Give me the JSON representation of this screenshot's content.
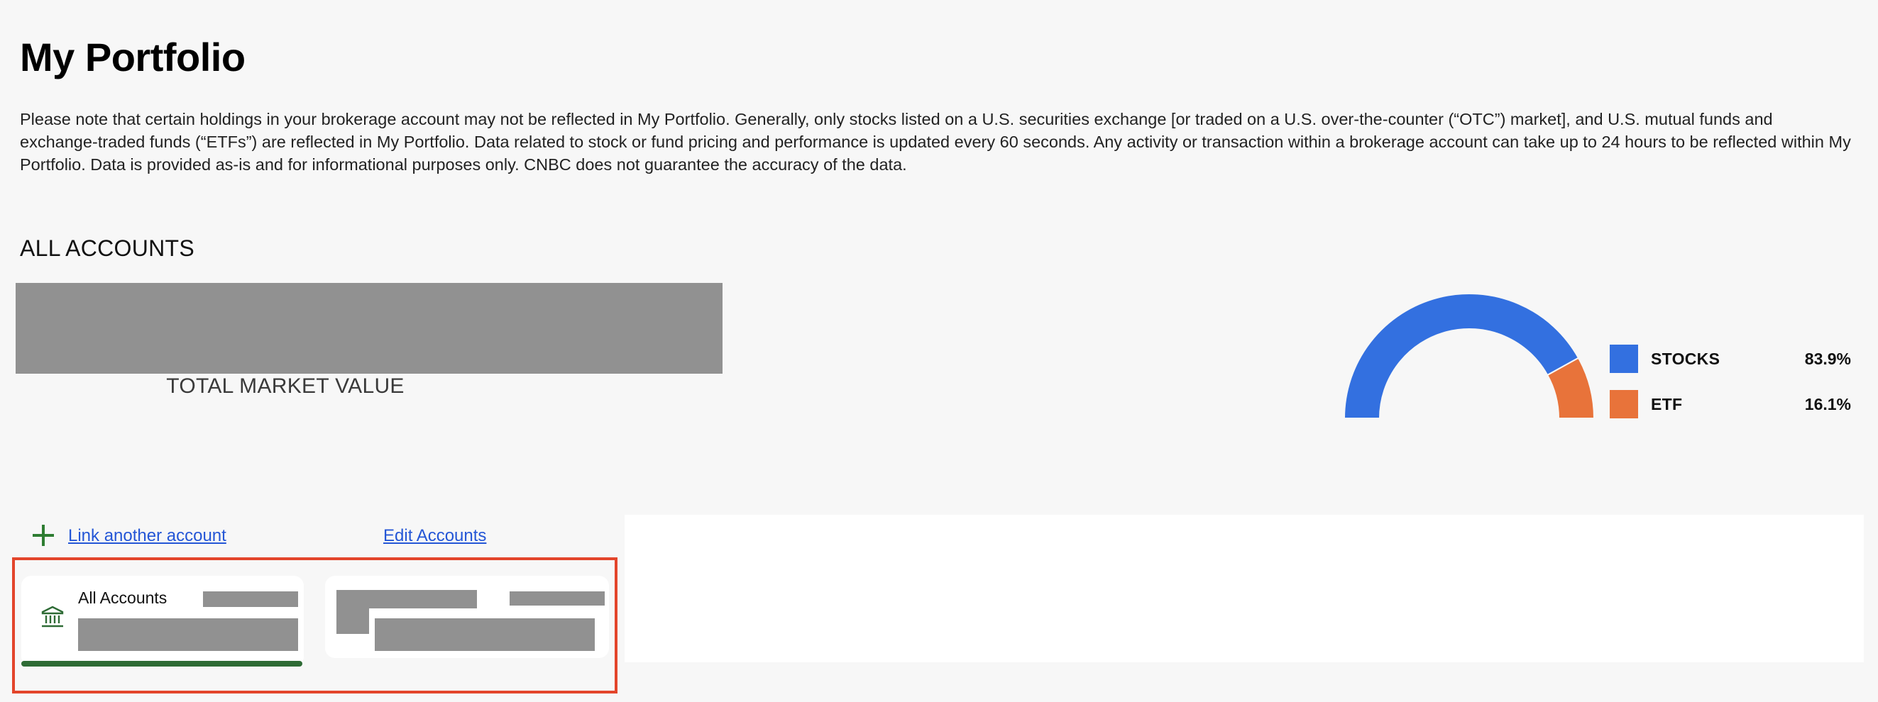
{
  "page": {
    "title": "My Portfolio",
    "disclaimer": "Please note that certain holdings in your brokerage account may not be reflected in My Portfolio. Generally, only stocks listed on a U.S. securities exchange [or traded on a U.S. over-the-counter (“OTC”) market], and U.S. mutual funds and exchange-traded funds (“ETFs”) are reflected in My Portfolio. Data related to stock or fund pricing and performance is updated every 60 seconds. Any activity or transaction within a brokerage account can take up to 24 hours to be reflected within My Portfolio. Data is provided as-is and for informational purposes only. CNBC does not guarantee the accuracy of the data."
  },
  "summary": {
    "section_title": "ALL ACCOUNTS",
    "total_market_value_label": "TOTAL MARKET VALUE"
  },
  "allocation": {
    "items": [
      {
        "name": "STOCKS",
        "percent": "83.9%",
        "value": 83.9,
        "color": "#3370e0"
      },
      {
        "name": "ETF",
        "percent": "16.1%",
        "value": 16.1,
        "color": "#e8733a"
      }
    ]
  },
  "accounts": {
    "link_another_label": "Link another account",
    "edit_label": "Edit Accounts",
    "cards": [
      {
        "label": "All Accounts",
        "icon": "bank-icon",
        "selected": true
      },
      {
        "label": "",
        "icon": "",
        "selected": false
      }
    ],
    "accent_color": "#2e6b35",
    "highlight_color": "#e3452b"
  }
}
